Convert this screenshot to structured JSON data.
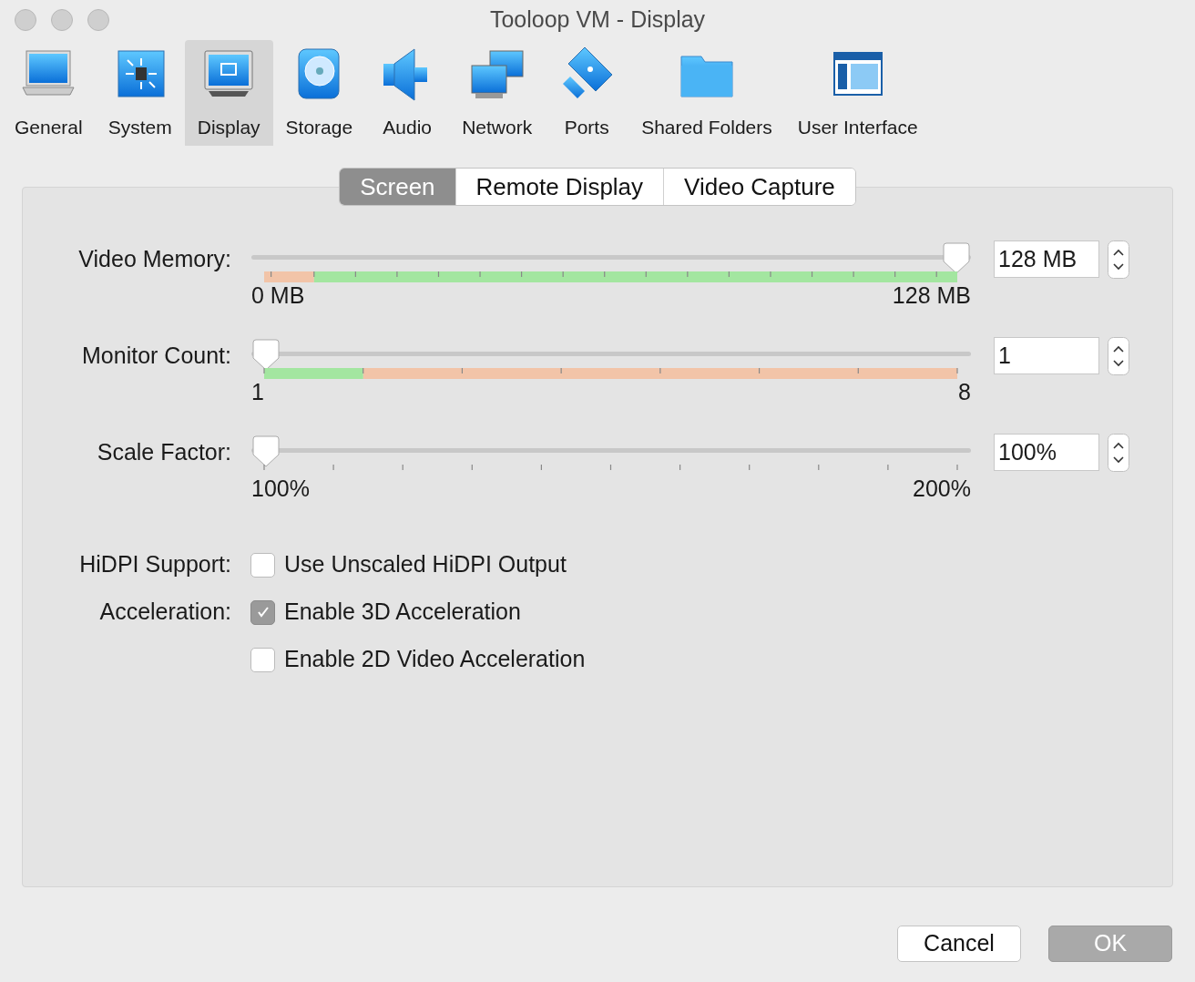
{
  "window": {
    "title": "Tooloop VM - Display"
  },
  "toolbar": [
    {
      "kind": "general",
      "label": "General",
      "selected": false
    },
    {
      "kind": "system",
      "label": "System",
      "selected": false
    },
    {
      "kind": "display",
      "label": "Display",
      "selected": true
    },
    {
      "kind": "storage",
      "label": "Storage",
      "selected": false
    },
    {
      "kind": "audio",
      "label": "Audio",
      "selected": false
    },
    {
      "kind": "network",
      "label": "Network",
      "selected": false
    },
    {
      "kind": "ports",
      "label": "Ports",
      "selected": false
    },
    {
      "kind": "folder",
      "label": "Shared Folders",
      "selected": false
    },
    {
      "kind": "ui",
      "label": "User Interface",
      "selected": false
    }
  ],
  "tabs": [
    {
      "label": "Screen",
      "selected": true
    },
    {
      "label": "Remote Display",
      "selected": false
    },
    {
      "label": "Video Capture",
      "selected": false
    }
  ],
  "sliders": [
    {
      "kind": "memory",
      "label": "Video Memory:",
      "level": 1,
      "min_label": "0 MB",
      "max_label": "128 MB",
      "value": "128 MB"
    },
    {
      "kind": "monitors",
      "label": "Monitor Count:",
      "level": 0,
      "min_label": "1",
      "max_label": "8",
      "value": "1"
    },
    {
      "kind": "scale",
      "label": "Scale Factor:",
      "level": 0,
      "min_label": "100%",
      "max_label": "200%",
      "value": "100%"
    }
  ],
  "options": [
    {
      "label": "HiDPI Support:",
      "text": "Use Unscaled HiDPI Output",
      "checked": false
    },
    {
      "label": "Acceleration:",
      "text": "Enable 3D Acceleration",
      "checked": true
    },
    {
      "text": "Enable 2D Video Acceleration",
      "checked": false
    }
  ],
  "buttons": [
    {
      "kind": "default",
      "label": "Cancel"
    },
    {
      "kind": "primary",
      "label": "OK"
    }
  ]
}
